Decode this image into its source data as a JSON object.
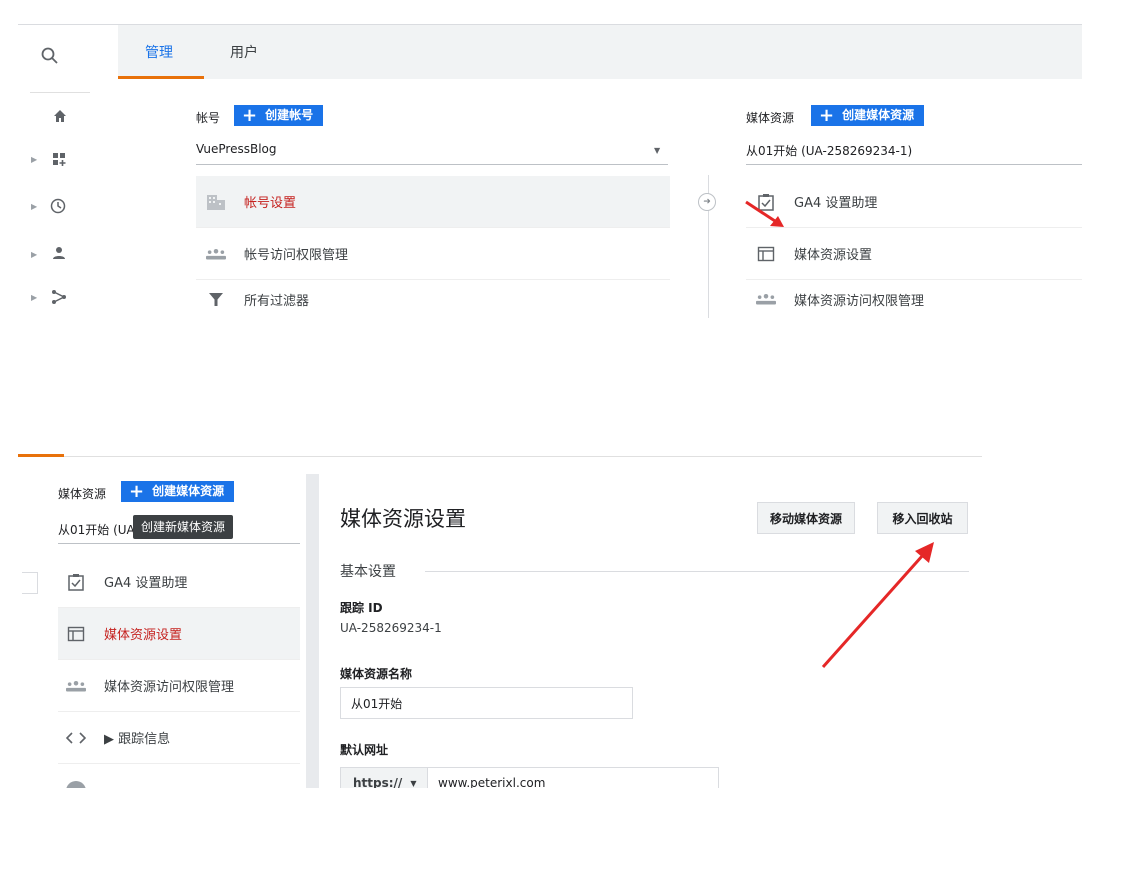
{
  "top": {
    "tabs": [
      {
        "label": "管理"
      },
      {
        "label": "用户"
      }
    ],
    "account": {
      "column_title": "帐号",
      "create_label": "创建帐号",
      "selected": "VuePressBlog",
      "menu": [
        {
          "label": "帐号设置",
          "icon": "building-icon",
          "active": true
        },
        {
          "label": "帐号访问权限管理",
          "icon": "people-icon",
          "active": false
        },
        {
          "label": "所有过滤器",
          "icon": "filter-icon",
          "active": false
        }
      ]
    },
    "property": {
      "column_title": "媒体资源",
      "create_label": "创建媒体资源",
      "selected": "从01开始 (UA-258269234-1)",
      "menu": [
        {
          "label": "GA4 设置助理",
          "icon": "clipboard-check-icon"
        },
        {
          "label": "媒体资源设置",
          "icon": "window-icon"
        },
        {
          "label": "媒体资源访问权限管理",
          "icon": "people-icon"
        }
      ]
    }
  },
  "bottom": {
    "property": {
      "column_title": "媒体资源",
      "create_label": "创建媒体资源",
      "selected_partial": "从01开始 (UA",
      "tooltip": "创建新媒体资源",
      "menu": [
        {
          "label": "GA4 设置助理",
          "icon": "clipboard-check-icon",
          "active": false
        },
        {
          "label": "媒体资源设置",
          "icon": "window-icon",
          "active": true
        },
        {
          "label": "媒体资源访问权限管理",
          "icon": "people-icon",
          "active": false
        },
        {
          "label": "▶ 跟踪信息",
          "icon": "code-icon",
          "active": false
        }
      ]
    },
    "settings": {
      "title": "媒体资源设置",
      "move_button": "移动媒体资源",
      "trash_button": "移入回收站",
      "section_basic": "基本设置",
      "tracking_id_label": "跟踪 ID",
      "tracking_id_value": "UA-258269234-1",
      "property_name_label": "媒体资源名称",
      "property_name_value": "从01开始",
      "default_url_label": "默认网址",
      "protocol": "https://",
      "url_value": "www.peterixl.com"
    }
  },
  "colors": {
    "accent_blue": "#1a73e8",
    "orange": "#e8710a",
    "active_red": "#c5221f",
    "arrow_red": "#e52727"
  }
}
